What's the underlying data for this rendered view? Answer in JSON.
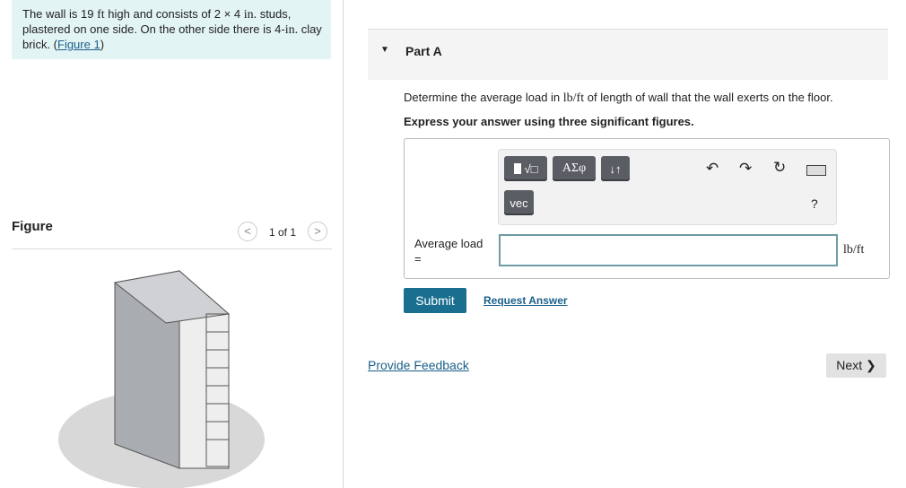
{
  "problem": {
    "text_1": "The wall is 19 ",
    "ft": "ft",
    "text_2": " high and consists of 2 × 4 ",
    "in1": "in.",
    "text_3": " studs, plastered on one side. On the other side there is 4-",
    "in2": "in.",
    "text_4": " clay brick. (",
    "figure_link": "Figure 1",
    "text_5": ")"
  },
  "figure": {
    "label": "Figure",
    "pager": "1 of 1"
  },
  "part": {
    "title": "Part A",
    "question_1": "Determine the average load in ",
    "unit_inline": "lb/ft",
    "question_2": " of length of wall that the wall exerts on the floor.",
    "instruction": "Express your answer using three significant figures."
  },
  "toolbar": {
    "templates": "√□",
    "greek": "ΑΣφ",
    "arrows": "↓↑",
    "vec": "vec",
    "help": "?"
  },
  "answer": {
    "label": "Average load",
    "equals": "=",
    "value": "",
    "unit": "lb/ft"
  },
  "actions": {
    "submit": "Submit",
    "request": "Request Answer",
    "feedback": "Provide Feedback",
    "next": "Next ❯"
  },
  "colors": {
    "accent": "#1a6f91",
    "panel": "#e3f4f5"
  }
}
